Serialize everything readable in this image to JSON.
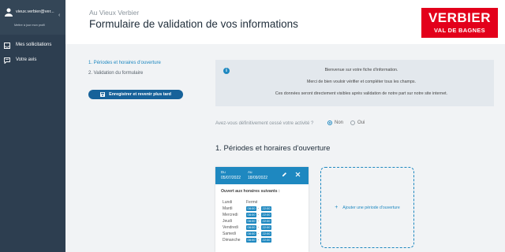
{
  "sidebar": {
    "user_email": "vieux.verbier@ver...",
    "user_subtitle": "Mettre à jour mon profil",
    "items": [
      {
        "label": "Mes sollicitations",
        "icon": "inbox-icon"
      },
      {
        "label": "Votre avis",
        "icon": "comment-icon"
      }
    ]
  },
  "header": {
    "subtitle": "Au Vieux Verbier",
    "title": "Formulaire de validation de vos informations",
    "logo_main": "VERBIER",
    "logo_sub": "VAL DE BAGNES"
  },
  "steps": [
    "1. Périodes et horaires d'ouverture",
    "2. Validation du formulaire"
  ],
  "save_button": "Enregistrer et revenir plus tard",
  "info": {
    "line1": "Bienvenue sur votre fiche d'information.",
    "line2": "Merci de bien vouloir vérifier et compléter tous les champs.",
    "line3": "Ces données seront directement visibles après validation de notre part sur notre site internet."
  },
  "question": {
    "text": "Avez-vous définitivement cessé votre activité ?",
    "options": [
      "Non",
      "Oui"
    ],
    "selected": "Non"
  },
  "section_title": "1. Périodes et horaires d'ouverture",
  "period": {
    "from_label": "Du",
    "from_date": "05/07/2022",
    "to_label": "Au",
    "to_date": "18/09/2022",
    "subtitle": "Ouvert aux horaires suivants :",
    "closed_label": "Fermé",
    "days": [
      {
        "day": "Lundi",
        "closed": true
      },
      {
        "day": "Mardi",
        "open": "08:00",
        "close": "22:00"
      },
      {
        "day": "Mercredi",
        "open": "08:00",
        "close": "22:00"
      },
      {
        "day": "Jeudi",
        "open": "08:00",
        "close": "22:00"
      },
      {
        "day": "Vendredi",
        "open": "08:00",
        "close": "22:00"
      },
      {
        "day": "Samedi",
        "open": "08:00",
        "close": "22:00"
      },
      {
        "day": "Dimanche",
        "open": "08:00",
        "close": "22:00"
      }
    ]
  },
  "add_period_label": "Ajouter une période d'ouverture",
  "colors": {
    "sidebar": "#2d3e50",
    "accent": "#1e88c0",
    "button": "#17629a",
    "brand_red": "#e3001b"
  }
}
